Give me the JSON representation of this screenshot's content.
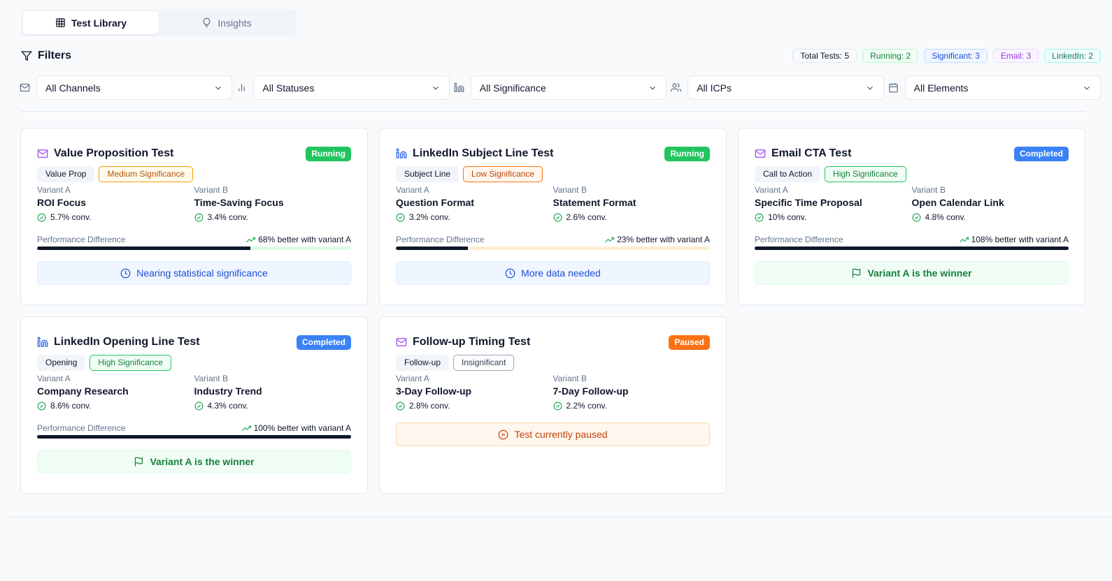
{
  "tabs": [
    {
      "label": "Test Library",
      "icon": "table-icon",
      "active": true
    },
    {
      "label": "Insights",
      "icon": "lightbulb-icon",
      "active": false
    }
  ],
  "filters": {
    "title": "Filters",
    "summary": {
      "total": "Total Tests: 5",
      "running": "Running: 2",
      "significant": "Significant: 3",
      "email": "Email: 3",
      "linkedin": "LinkedIn: 2"
    },
    "selects": {
      "channel": "All Channels",
      "status": "All Statuses",
      "significance": "All Significance",
      "icp": "All ICPs",
      "element": "All Elements"
    }
  },
  "labels": {
    "variant_a": "Variant A",
    "variant_b": "Variant B",
    "performance": "Performance Difference"
  },
  "colors": {
    "running": "#22c55e",
    "completed": "#3b82f6",
    "paused": "#f97316",
    "email_icon": "#a855f7",
    "linkedin_icon": "#2563eb"
  },
  "tests": [
    {
      "title": "Value Proposition Test",
      "channel": "Email",
      "status": "Running",
      "element": "Value Prop",
      "significance": "Medium Significance",
      "variant_a": {
        "name": "ROI Focus",
        "conv": "5.7% conv."
      },
      "variant_b": {
        "name": "Time-Saving Focus",
        "conv": "3.4% conv."
      },
      "performance": "68% better with variant A",
      "bar_fraction": 0.68,
      "notice": "Nearing statistical significance"
    },
    {
      "title": "LinkedIn Subject Line Test",
      "channel": "LinkedIn",
      "status": "Running",
      "element": "Subject Line",
      "significance": "Low Significance",
      "variant_a": {
        "name": "Question Format",
        "conv": "3.2% conv."
      },
      "variant_b": {
        "name": "Statement Format",
        "conv": "2.6% conv."
      },
      "performance": "23% better with variant A",
      "bar_fraction": 0.23,
      "notice": "More data needed"
    },
    {
      "title": "Email CTA Test",
      "channel": "Email",
      "status": "Completed",
      "element": "Call to Action",
      "significance": "High Significance",
      "variant_a": {
        "name": "Specific Time Proposal",
        "conv": "10% conv."
      },
      "variant_b": {
        "name": "Open Calendar Link",
        "conv": "4.8% conv."
      },
      "performance": "108% better with variant A",
      "bar_fraction": 1.0,
      "notice": "Variant A is the winner"
    },
    {
      "title": "LinkedIn Opening Line Test",
      "channel": "LinkedIn",
      "status": "Completed",
      "element": "Opening",
      "significance": "High Significance",
      "variant_a": {
        "name": "Company Research",
        "conv": "8.6% conv."
      },
      "variant_b": {
        "name": "Industry Trend",
        "conv": "4.3% conv."
      },
      "performance": "100% better with variant A",
      "bar_fraction": 1.0,
      "notice": "Variant A is the winner"
    },
    {
      "title": "Follow-up Timing Test",
      "channel": "Email",
      "status": "Paused",
      "element": "Follow-up",
      "significance": "Insignificant",
      "variant_a": {
        "name": "3-Day Follow-up",
        "conv": "2.8% conv."
      },
      "variant_b": {
        "name": "7-Day Follow-up",
        "conv": "2.2% conv."
      },
      "notice": "Test currently paused"
    }
  ]
}
